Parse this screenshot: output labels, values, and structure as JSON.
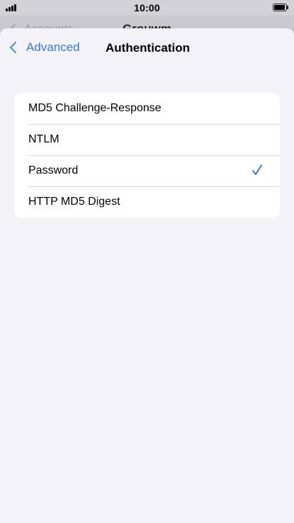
{
  "status_bar": {
    "time": "10:00"
  },
  "behind": {
    "back_label": "Accounts",
    "title": "Grouwm"
  },
  "nav": {
    "back_label": "Advanced",
    "title": "Authentication",
    "accent_color": "#3a7ad5"
  },
  "options": [
    {
      "label": "MD5 Challenge-Response",
      "selected": false
    },
    {
      "label": "NTLM",
      "selected": false
    },
    {
      "label": "Password",
      "selected": true
    },
    {
      "label": "HTTP MD5 Digest",
      "selected": false
    }
  ],
  "icons": {
    "selected_marker": "checkmark-icon",
    "back": "chevron-left-icon"
  }
}
